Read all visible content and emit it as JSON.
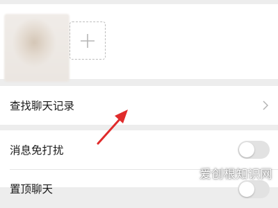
{
  "members": {
    "add_icon": "plus-icon"
  },
  "search_row": {
    "label": "查找聊天记录",
    "icon": "chevron-right-icon"
  },
  "settings": {
    "mute": {
      "label": "消息免打扰",
      "on": false
    },
    "pin": {
      "label": "置顶聊天",
      "on": false
    }
  },
  "watermark": "爱创根知识网",
  "colors": {
    "background": "#ededed",
    "card": "#ffffff",
    "annotation_arrow": "#e02b2b",
    "toggle_off": "#e2e2e2"
  }
}
